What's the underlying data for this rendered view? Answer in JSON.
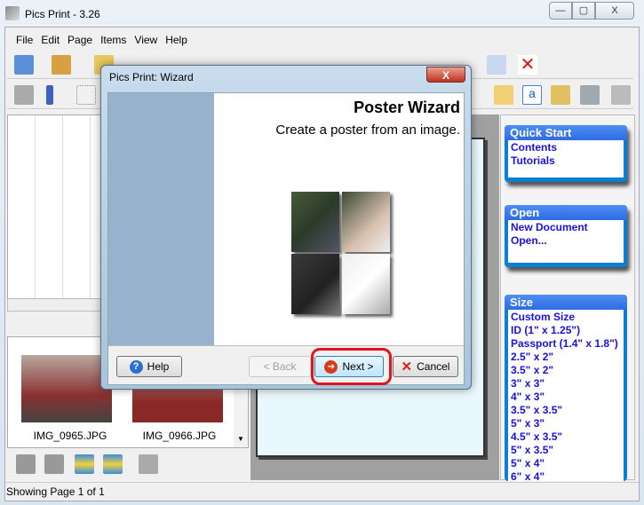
{
  "window": {
    "title": "Pics Print - 3.26",
    "minimize": "—",
    "maximize": "▢",
    "close": "X"
  },
  "menu": [
    "File",
    "Edit",
    "Page",
    "Items",
    "View",
    "Help"
  ],
  "thumbnails": [
    {
      "name": "IMG_0965.JPG"
    },
    {
      "name": "IMG_0966.JPG"
    }
  ],
  "status": {
    "text": "Showing Page 1 of 1"
  },
  "dialog": {
    "title": "Pics Print: Wizard",
    "close": "X",
    "heading": "Poster Wizard",
    "subtitle": "Create a poster from an image.",
    "buttons": {
      "help": "Help",
      "back": "< Back",
      "next": "Next >",
      "cancel": "Cancel"
    }
  },
  "panels": {
    "quick_start": {
      "title": "Quick Start",
      "items": [
        "Contents",
        "Tutorials"
      ]
    },
    "open": {
      "title": "Open",
      "items": [
        "New Document",
        "Open..."
      ]
    },
    "size": {
      "title": "Size",
      "items": [
        "Custom Size",
        "ID (1\" x 1.25\")",
        "Passport (1.4\" x 1.8\")",
        "2.5\" x 2\"",
        "3.5\" x 2\"",
        "3\" x 3\"",
        "4\" x 3\"",
        "3.5\" x 3.5\"",
        "5\" x 3\"",
        "4.5\" x 3.5\"",
        "5\" x 3.5\"",
        "5\" x 4\"",
        "6\" x 4\""
      ]
    }
  },
  "colors": {
    "accent": "#2f6be3",
    "link": "#1a10e0",
    "highlight": "#e0141e",
    "wizard_strip": "#98b2cd"
  }
}
